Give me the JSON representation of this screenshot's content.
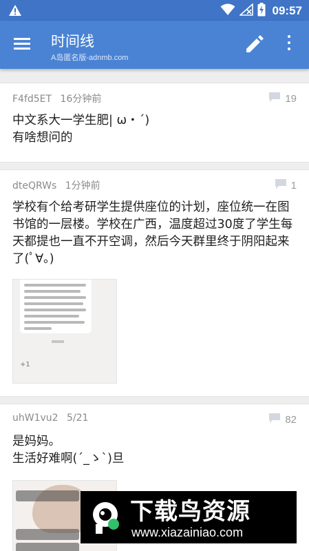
{
  "status_bar": {
    "time": "09:57",
    "icons": [
      "warning-icon",
      "wifi-icon",
      "no-signal-icon",
      "battery-charging-icon"
    ]
  },
  "app_bar": {
    "title": "时间线",
    "subtitle": "A岛匿名版-adnmb.com",
    "icons": [
      "menu-icon",
      "edit-icon",
      "more-vert-icon"
    ]
  },
  "posts": [
    {
      "uid": "F4fd5ET",
      "time": "16分钟前",
      "replies": "19",
      "content": "中文系大一学生肥| ω・´)\n有啥想问的",
      "has_image": false
    },
    {
      "uid": "dteQRWs",
      "time": "1分钟前",
      "replies": "1",
      "content": "学校有个给考研学生提供座位的计划，座位统一在图书馆的一层楼。学校在广西，温度超过30度了学生每天都提也一直不开空调，然后今天群里终于阴阳起来了(ﾟ∀。)",
      "has_image": true
    },
    {
      "uid": "uhW1vu2",
      "time": "5/21",
      "replies": "82",
      "content": "是妈妈。\n生活好难啊(´_ゝ`)旦",
      "has_image": true
    }
  ],
  "watermark": {
    "title": "下载鸟资源",
    "url": "www.xiazainiao.com",
    "colors": {
      "background": "#000000",
      "text": "#ffffff"
    }
  },
  "colors": {
    "status_bar": "#3f74c7",
    "app_bar": "#4a83d4",
    "feed_background": "#eeeeee",
    "card_background": "#ffffff",
    "meta_text": "#8a8a8a"
  }
}
